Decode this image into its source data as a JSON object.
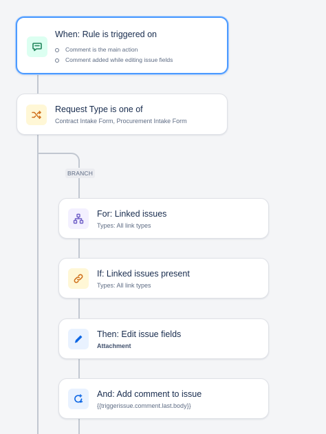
{
  "trigger": {
    "title": "When: Rule is triggered on",
    "bullets": [
      "Comment is the main action",
      "Comment added while editing issue fields"
    ],
    "icon": "comment-icon"
  },
  "condition": {
    "title": "Request Type is one of",
    "subtitle": "Contract Intake Form, Procurement Intake Form",
    "icon": "shuffle-icon"
  },
  "branch": {
    "label": "BRANCH"
  },
  "branch_items": [
    {
      "title": "For: Linked issues",
      "subtitle": "Types: All link types",
      "icon": "hierarchy-icon"
    },
    {
      "title": "If: Linked issues present",
      "subtitle": "Types: All link types",
      "icon": "link-icon"
    },
    {
      "title": "Then: Edit issue fields",
      "subtitle": "Attachment",
      "icon": "pencil-icon"
    },
    {
      "title": "And: Add comment to issue",
      "subtitle": "{{triggerissue.comment.last.body}}",
      "icon": "comment-add-icon"
    }
  ],
  "colors": {
    "trigger_icon_bg": "#dcfff1",
    "condition_icon_bg": "#fff7d6",
    "for_icon_bg": "#f3f0ff",
    "if_icon_bg": "#fff7d6",
    "action_icon_bg": "#e9f2ff",
    "selected_border": "#4c9aff"
  }
}
